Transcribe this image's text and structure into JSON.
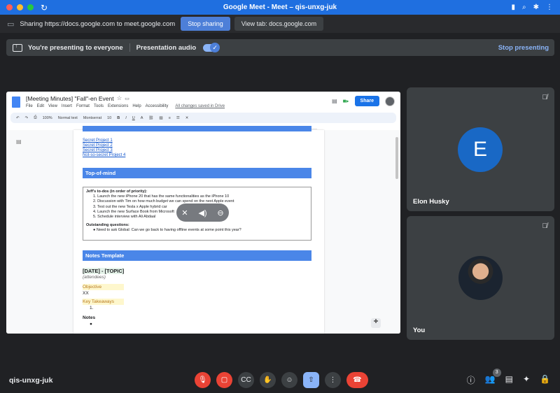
{
  "window": {
    "title": "Google Meet - Meet – qis-unxg-juk"
  },
  "sharebar": {
    "message": "Sharing https://docs.google.com to meet.google.com",
    "stop_sharing": "Stop sharing",
    "view_tab": "View tab: docs.google.com"
  },
  "presentbar": {
    "presenting_text": "You're presenting to everyone",
    "audio_label": "Presentation audio",
    "stop_label": "Stop presenting"
  },
  "doc": {
    "title": "[Meeting Minutes] \"Fall\"-en Event",
    "menu": [
      "File",
      "Edit",
      "View",
      "Insert",
      "Format",
      "Tools",
      "Extensions",
      "Help",
      "Accessibility"
    ],
    "saved": "All changes saved in Drive",
    "share": "Share",
    "toolbar": {
      "zoom": "100%",
      "style": "Normal text",
      "font": "Montserrat",
      "size": "10"
    },
    "links": [
      "Secret Project 1",
      "Secret Project 2",
      "Secret Project 3",
      "Not-so-secret Project 4"
    ],
    "section1": "Top-of-mind",
    "todos_title": "Jeff's to-dos (in order of priority):",
    "todos": [
      "1.   Launch the new iPhone 20 that has the same functionalities as the iPhone 10",
      "2.   Discussion with Tim on how much budget we can spend on the next Apple event",
      "3.   Test out the new Tesla x Apple hybrid car",
      "4.   Launch the new Surface Book from Microsoft",
      "5.   Schedule interview with Ali Abdaal"
    ],
    "questions_title": "Outstanding questions:",
    "question": "●   Need to ask Global: Can we go back to having offline events at some point this year?",
    "section2": "Notes Template",
    "date_topic": "[DATE] - [TOPIC]",
    "attendees": "(attendees)",
    "objective": "Objective",
    "xx": "XX",
    "key_takeaways": "Key Takeaways",
    "kt_item": "1.",
    "notes": "Notes",
    "notes_bullet": "●"
  },
  "participants": [
    {
      "name": "Elon Husky",
      "initial": "E",
      "avatar_color": "#1968c5"
    },
    {
      "name": "You"
    }
  ],
  "meeting": {
    "code": "qis-unxg-juk",
    "people_count": "3"
  }
}
